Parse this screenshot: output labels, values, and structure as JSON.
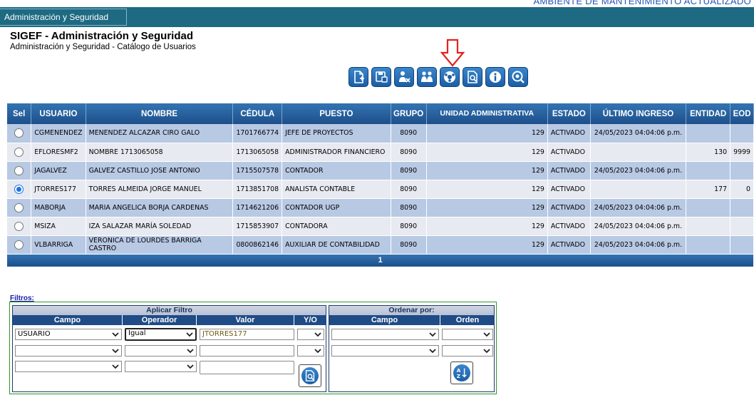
{
  "banner": {
    "text": "AMBIENTE DE MANTENIMIENTO ACTUALIZADO"
  },
  "app_tab": {
    "label": "Administración y Seguridad"
  },
  "page": {
    "title": "SIGEF - Administración y Seguridad",
    "subtitle": "Administración y Seguridad - Catálogo de Usuarios"
  },
  "toolbar": {
    "icons": [
      "new-document-icon",
      "save-icon",
      "remove-user-icon",
      "users-icon",
      "roles-icon",
      "search-document-icon",
      "info-icon",
      "view-icon"
    ]
  },
  "table": {
    "headers": [
      "Sel",
      "USUARIO",
      "NOMBRE",
      "CÉDULA",
      "PUESTO",
      "GRUPO",
      "UNIDAD ADMINISTRATIVA",
      "ESTADO",
      "ÚLTIMO INGRESO",
      "ENTIDAD",
      "EOD"
    ],
    "rows": [
      {
        "selected": false,
        "usuario": "CGMENENDEZ",
        "nombre": "MENENDEZ ALCAZAR CIRO GALO",
        "cedula": "1701766774",
        "puesto": "JEFE DE PROYECTOS",
        "grupo": "8090",
        "unidad": "129",
        "estado": "ACTIVADO",
        "ultimo": "24/05/2023 04:04:06 p.m.",
        "entidad": "",
        "eod": ""
      },
      {
        "selected": false,
        "usuario": "EFLORESMF2",
        "nombre": "NOMBRE 1713065058",
        "cedula": "1713065058",
        "puesto": "ADMINISTRADOR FINANCIERO",
        "grupo": "8090",
        "unidad": "129",
        "estado": "ACTIVADO",
        "ultimo": "",
        "entidad": "130",
        "eod": "9999"
      },
      {
        "selected": false,
        "usuario": "JAGALVEZ",
        "nombre": "GALVEZ CASTILLO JOSE ANTONIO",
        "cedula": "1715507578",
        "puesto": "CONTADOR",
        "grupo": "8090",
        "unidad": "129",
        "estado": "ACTIVADO",
        "ultimo": "24/05/2023 04:04:06 p.m.",
        "entidad": "",
        "eod": ""
      },
      {
        "selected": true,
        "usuario": "JTORRES177",
        "nombre": "TORRES ALMEIDA JORGE MANUEL",
        "cedula": "1713851708",
        "puesto": "ANALISTA CONTABLE",
        "grupo": "8090",
        "unidad": "129",
        "estado": "ACTIVADO",
        "ultimo": "",
        "entidad": "177",
        "eod": "0"
      },
      {
        "selected": false,
        "usuario": "MABORJA",
        "nombre": "MARIA ANGELICA BORJA CARDENAS",
        "cedula": "1714621206",
        "puesto": "CONTADOR UGP",
        "grupo": "8090",
        "unidad": "129",
        "estado": "ACTIVADO",
        "ultimo": "24/05/2023 04:04:06 p.m.",
        "entidad": "",
        "eod": ""
      },
      {
        "selected": false,
        "usuario": "MSIZA",
        "nombre": "IZA SALAZAR MARÍA SOLEDAD",
        "cedula": "1715853907",
        "puesto": "CONTADORA",
        "grupo": "8090",
        "unidad": "129",
        "estado": "ACTIVADO",
        "ultimo": "24/05/2023 04:04:06 p.m.",
        "entidad": "",
        "eod": ""
      },
      {
        "selected": false,
        "usuario": "VLBARRIGA",
        "nombre": "VERONICA DE LOURDES BARRIGA CASTRO",
        "cedula": "0800862146",
        "puesto": "AUXILIAR DE CONTABILIDAD",
        "grupo": "8090",
        "unidad": "129",
        "estado": "ACTIVADO",
        "ultimo": "24/05/2023 04:04:06 p.m.",
        "entidad": "",
        "eod": ""
      }
    ],
    "page_number": "1"
  },
  "filters": {
    "link_label": "Filtros:",
    "apply": {
      "caption": "Aplicar Filtro",
      "headers": {
        "campo": "Campo",
        "operador": "Operador",
        "valor": "Valor",
        "yo": "Y/O"
      },
      "row1": {
        "campo": "USUARIO",
        "operador": "Igual",
        "valor": "JTORRES177",
        "yo": ""
      }
    },
    "order": {
      "caption": "Ordenar por:",
      "headers": {
        "campo": "Campo",
        "orden": "Orden"
      }
    }
  },
  "colors": {
    "appbar": "#1d6a82",
    "header_blue": "#1d4f8a",
    "row_odd": "#b8c9e4",
    "row_even": "#e7eaf0",
    "filter_border": "#2a9a2a"
  }
}
